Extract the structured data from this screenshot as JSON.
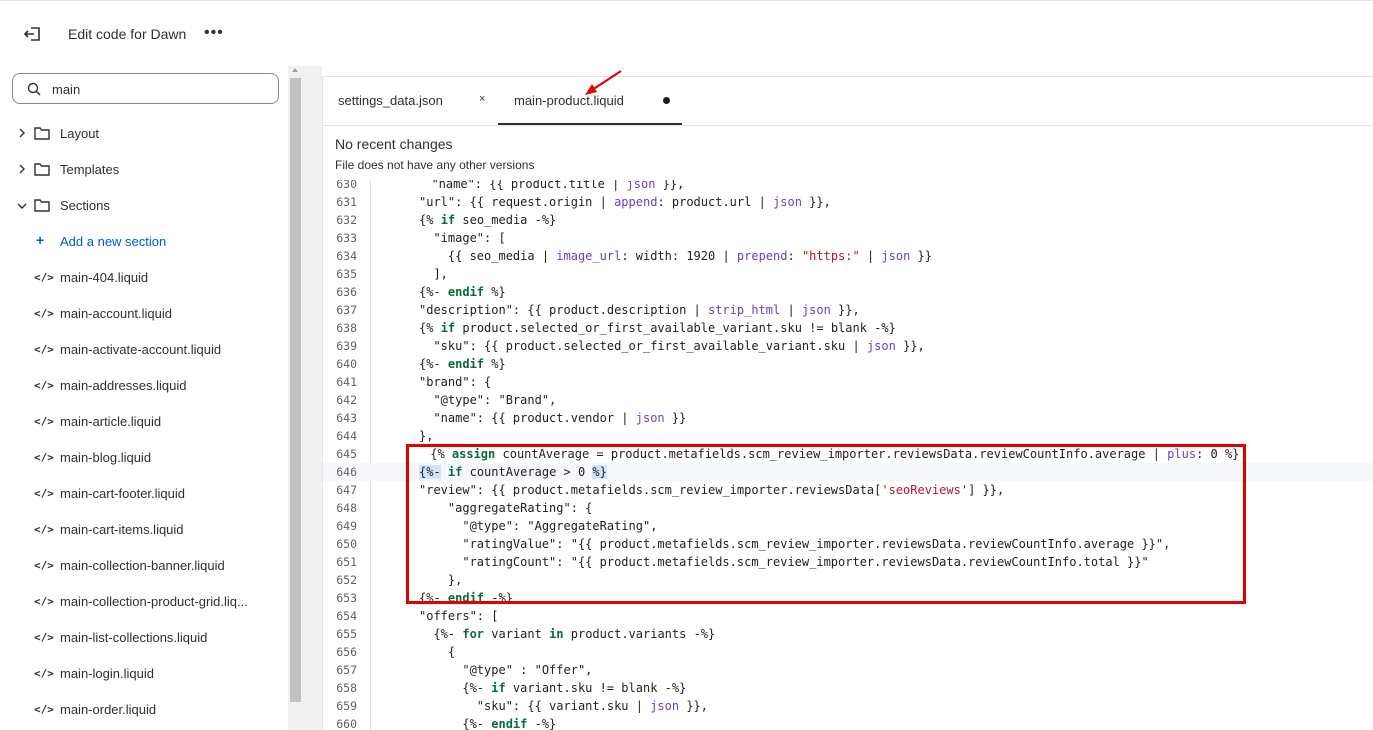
{
  "header": {
    "title": "Edit code for Dawn",
    "more": "•••"
  },
  "sidebar": {
    "search": {
      "value": "main",
      "placeholder": ""
    },
    "folders": [
      {
        "label": "Layout",
        "expanded": false
      },
      {
        "label": "Templates",
        "expanded": false
      },
      {
        "label": "Sections",
        "expanded": true
      }
    ],
    "add_section": "Add a new section",
    "files": [
      "main-404.liquid",
      "main-account.liquid",
      "main-activate-account.liquid",
      "main-addresses.liquid",
      "main-article.liquid",
      "main-blog.liquid",
      "main-cart-footer.liquid",
      "main-cart-items.liquid",
      "main-collection-banner.liquid",
      "main-collection-product-grid.liq...",
      "main-list-collections.liquid",
      "main-login.liquid",
      "main-order.liquid"
    ]
  },
  "tabs": [
    {
      "label": "settings_data.json",
      "close": "×",
      "active": false
    },
    {
      "label": "main-product.liquid",
      "unsaved": true,
      "active": true
    }
  ],
  "editor_status": {
    "title": "No recent changes",
    "subtitle": "File does not have any other versions"
  },
  "code_lines": [
    {
      "n": "630",
      "html": "<span>  \"name\": {{ product.title | <span class='f'>json</span> }},</span>"
    },
    {
      "n": "631",
      "html": "\"url\": {{ request.origin | <span class='f'>append</span>: product.url | <span class='f'>json</span> }},"
    },
    {
      "n": "632",
      "html": "{% <span class='k'>if</span> seo_media -%}"
    },
    {
      "n": "633",
      "html": "  \"image\": ["
    },
    {
      "n": "634",
      "html": "    {{ seo_media | <span class='f'>image_url</span>: width: 1920 | <span class='f'>prepend</span>: <span class='s'>\"https:\"</span> | <span class='f'>json</span> }}"
    },
    {
      "n": "635",
      "html": "  ],"
    },
    {
      "n": "636",
      "html": "{%- <span class='k'>endif</span> %}"
    },
    {
      "n": "637",
      "html": "\"description\": {{ product.description | <span class='f'>strip_html</span> | <span class='f'>json</span> }},"
    },
    {
      "n": "638",
      "html": "{% <span class='k'>if</span> product.selected_or_first_available_variant.sku != blank -%}"
    },
    {
      "n": "639",
      "html": "  \"sku\": {{ product.selected_or_first_available_variant.sku | <span class='f'>json</span> }},"
    },
    {
      "n": "640",
      "html": "{%- <span class='k'>endif</span> %}"
    },
    {
      "n": "641",
      "html": "\"brand\": {"
    },
    {
      "n": "642",
      "html": "  \"@type\": \"Brand\","
    },
    {
      "n": "643",
      "html": "  \"name\": {{ product.vendor | <span class='f'>json</span> }}"
    },
    {
      "n": "644",
      "html": "},"
    },
    {
      "n": "645",
      "html": " {% <span class='k'>assign</span> countAverage = product.metafields.scm_review_importer.reviewsData.reviewCountInfo.average | <span class='f'>plus</span>: 0 %}"
    },
    {
      "n": "646",
      "html": "<span class='hl'>{%-</span> <span class='k'>if</span> countAverage &gt; 0 <span class='hl'>%}</span>",
      "active": true
    },
    {
      "n": "647",
      "html": "\"review\": {{ product.metafields.scm_review_importer.reviewsData[<span class='s'>'seoReviews'</span>] }},"
    },
    {
      "n": "648",
      "html": "    \"aggregateRating\": {"
    },
    {
      "n": "649",
      "html": "      \"@type\": \"AggregateRating\","
    },
    {
      "n": "650",
      "html": "      \"ratingValue\": \"{{ product.metafields.scm_review_importer.reviewsData.reviewCountInfo.average }}\","
    },
    {
      "n": "651",
      "html": "      \"ratingCount\": \"{{ product.metafields.scm_review_importer.reviewsData.reviewCountInfo.total }}\""
    },
    {
      "n": "652",
      "html": "    },"
    },
    {
      "n": "653",
      "html": "{%- <span class='k'>endif</span> -%}"
    },
    {
      "n": "654",
      "html": "\"offers\": ["
    },
    {
      "n": "655",
      "html": "  {%- <span class='k'>for</span> variant <span class='k'>in</span> product.variants -%}"
    },
    {
      "n": "656",
      "html": "    {"
    },
    {
      "n": "657",
      "html": "      \"@type\" : \"Offer\","
    },
    {
      "n": "658",
      "html": "      {%- <span class='k'>if</span> variant.sku != blank -%}"
    },
    {
      "n": "659",
      "html": "        \"sku\": {{ variant.sku | <span class='f'>json</span> }},"
    },
    {
      "n": "660",
      "html": "      {%- <span class='k'>endif</span> -%}"
    }
  ],
  "colors": {
    "annotation": "#e00000",
    "link": "#005bd3"
  }
}
